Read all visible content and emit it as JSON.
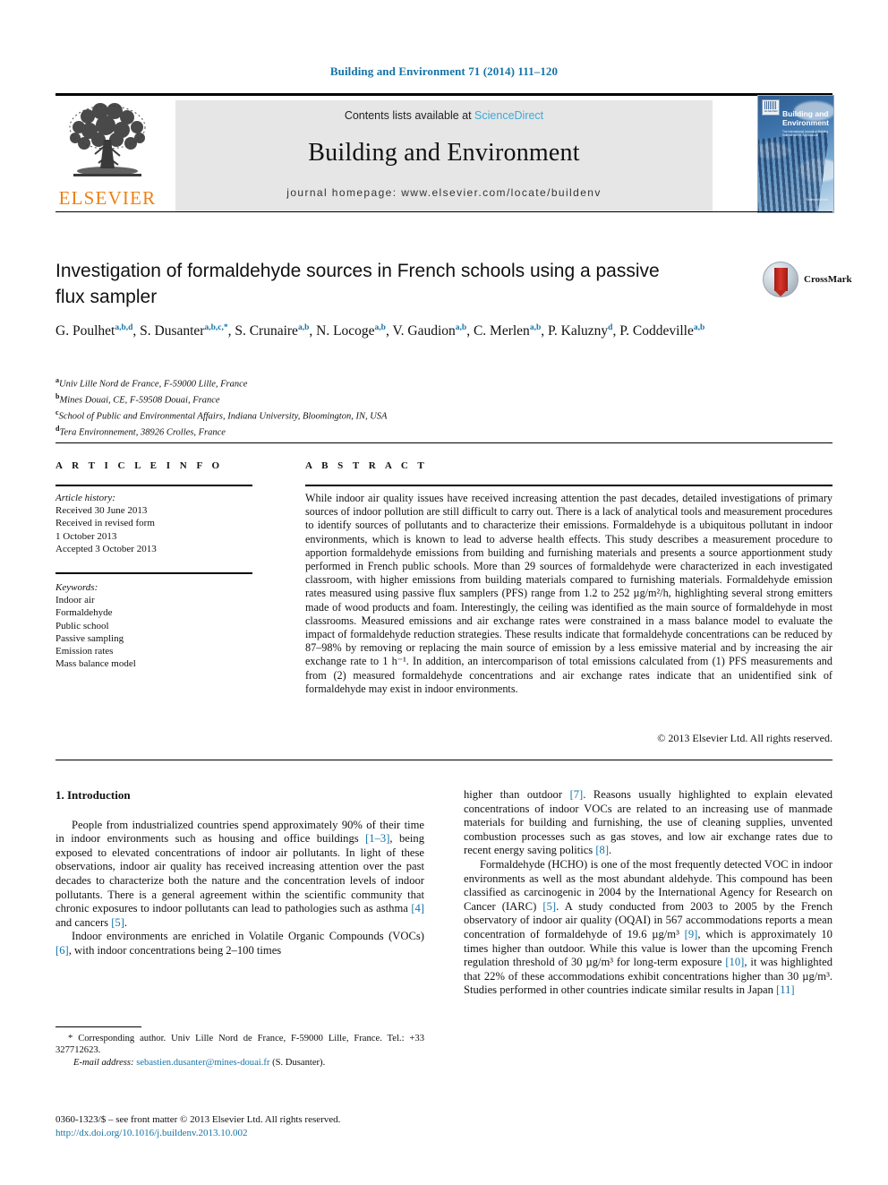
{
  "running_head": "Building and Environment 71 (2014) 111–120",
  "masthead": {
    "contents_prefix": "Contents lists available at ",
    "sciencedirect": "ScienceDirect",
    "journal_title": "Building and Environment",
    "homepage": "journal homepage: www.elsevier.com/locate/buildenv",
    "publisher_wordmark": "ELSEVIER",
    "cover": {
      "title": "Building and Environment",
      "subtitle": "The International Journal of Building Science and its Applications",
      "editor_line": "Editor-in-Chief: Prof. J. Srebric",
      "corner_mark": "ScienceDirect",
      "publisher_badge": "ELSEVIER"
    }
  },
  "crossmark": {
    "label": "CrossMark"
  },
  "article": {
    "title": "Investigation of formaldehyde sources in French schools using a passive flux sampler",
    "authors": [
      {
        "name": "G. Poulhet",
        "sup": "a,b,d",
        "sep": ", "
      },
      {
        "name": "S. Dusanter",
        "sup": "a,b,c,*",
        "sep": ", "
      },
      {
        "name": "S. Crunaire",
        "sup": "a,b",
        "sep": ", "
      },
      {
        "name": "N. Locoge",
        "sup": "a,b",
        "sep": ", "
      },
      {
        "name": "V. Gaudion",
        "sup": "a,b",
        "sep": ", "
      },
      {
        "name": "C. Merlen",
        "sup": "a,b",
        "sep": ", "
      },
      {
        "name": "P. Kaluzny",
        "sup": "d",
        "sep": ", "
      },
      {
        "name": "P. Coddeville",
        "sup": "a,b",
        "sep": ""
      }
    ],
    "affiliations": [
      {
        "mark": "a",
        "text": "Univ Lille Nord de France, F-59000 Lille, France"
      },
      {
        "mark": "b",
        "text": "Mines Douai, CE, F-59508 Douai, France"
      },
      {
        "mark": "c",
        "text": "School of Public and Environmental Affairs, Indiana University, Bloomington, IN, USA"
      },
      {
        "mark": "d",
        "text": "Tera Environnement, 38926 Crolles, France"
      }
    ]
  },
  "article_info": {
    "heading": "A R T I C L E   I N F O",
    "history_label": "Article history:",
    "history": [
      "Received 30 June 2013",
      "Received in revised form",
      "1 October 2013",
      "Accepted 3 October 2013"
    ],
    "keywords_label": "Keywords:",
    "keywords": [
      "Indoor air",
      "Formaldehyde",
      "Public school",
      "Passive sampling",
      "Emission rates",
      "Mass balance model"
    ]
  },
  "abstract": {
    "heading": "A B S T R A C T",
    "text": "While indoor air quality issues have received increasing attention the past decades, detailed investigations of primary sources of indoor pollution are still difficult to carry out. There is a lack of analytical tools and measurement procedures to identify sources of pollutants and to characterize their emissions. Formaldehyde is a ubiquitous pollutant in indoor environments, which is known to lead to adverse health effects. This study describes a measurement procedure to apportion formaldehyde emissions from building and furnishing materials and presents a source apportionment study performed in French public schools. More than 29 sources of formaldehyde were characterized in each investigated classroom, with higher emissions from building materials compared to furnishing materials. Formaldehyde emission rates measured using passive flux samplers (PFS) range from 1.2 to 252 µg/m²/h, highlighting several strong emitters made of wood products and foam. Interestingly, the ceiling was identified as the main source of formaldehyde in most classrooms. Measured emissions and air exchange rates were constrained in a mass balance model to evaluate the impact of formaldehyde reduction strategies. These results indicate that formaldehyde concentrations can be reduced by 87–98% by removing or replacing the main source of emission by a less emissive material and by increasing the air exchange rate to 1 h⁻¹. In addition, an intercomparison of total emissions calculated from (1) PFS measurements and from (2) measured formaldehyde concentrations and air exchange rates indicate that an unidentified sink of formaldehyde may exist in indoor environments.",
    "copyright": "© 2013 Elsevier Ltd. All rights reserved."
  },
  "body": {
    "section_heading": "1. Introduction",
    "left_paragraphs": [
      "People from industrialized countries spend approximately 90% of their time in indoor environments such as housing and office buildings [1–3], being exposed to elevated concentrations of indoor air pollutants. In light of these observations, indoor air quality has received increasing attention over the past decades to characterize both the nature and the concentration levels of indoor pollutants. There is a general agreement within the scientific community that chronic exposures to indoor pollutants can lead to pathologies such as asthma [4] and cancers [5].",
      "Indoor environments are enriched in Volatile Organic Compounds (VOCs) [6], with indoor concentrations being 2–100 times"
    ],
    "right_paragraphs": [
      "higher than outdoor [7]. Reasons usually highlighted to explain elevated concentrations of indoor VOCs are related to an increasing use of manmade materials for building and furnishing, the use of cleaning supplies, unvented combustion processes such as gas stoves, and low air exchange rates due to recent energy saving politics [8].",
      "Formaldehyde (HCHO) is one of the most frequently detected VOC in indoor environments as well as the most abundant aldehyde. This compound has been classified as carcinogenic in 2004 by the International Agency for Research on Cancer (IARC) [5]. A study conducted from 2003 to 2005 by the French observatory of indoor air quality (OQAI) in 567 accommodations reports a mean concentration of formaldehyde of 19.6 µg/m³ [9], which is approximately 10 times higher than outdoor. While this value is lower than the upcoming French regulation threshold of 30 µg/m³ for long-term exposure [10], it was highlighted that 22% of these accommodations exhibit concentrations higher than 30 µg/m³. Studies performed in other countries indicate similar results in Japan [11]"
    ]
  },
  "footnote": {
    "corresponding": "* Corresponding author. Univ Lille Nord de France, F-59000 Lille, France. Tel.: +33 327712623.",
    "email_label": "E-mail address:",
    "email": "sebastien.dusanter@mines-douai.fr",
    "email_suffix": "(S. Dusanter)."
  },
  "imprint": {
    "line1": "0360-1323/$ – see front matter © 2013 Elsevier Ltd. All rights reserved.",
    "doi": "http://dx.doi.org/10.1016/j.buildenv.2013.10.002"
  },
  "colors": {
    "link": "#1573a8",
    "sciencedirect": "#3ea8d8",
    "elsevier_orange": "#ec8013"
  }
}
